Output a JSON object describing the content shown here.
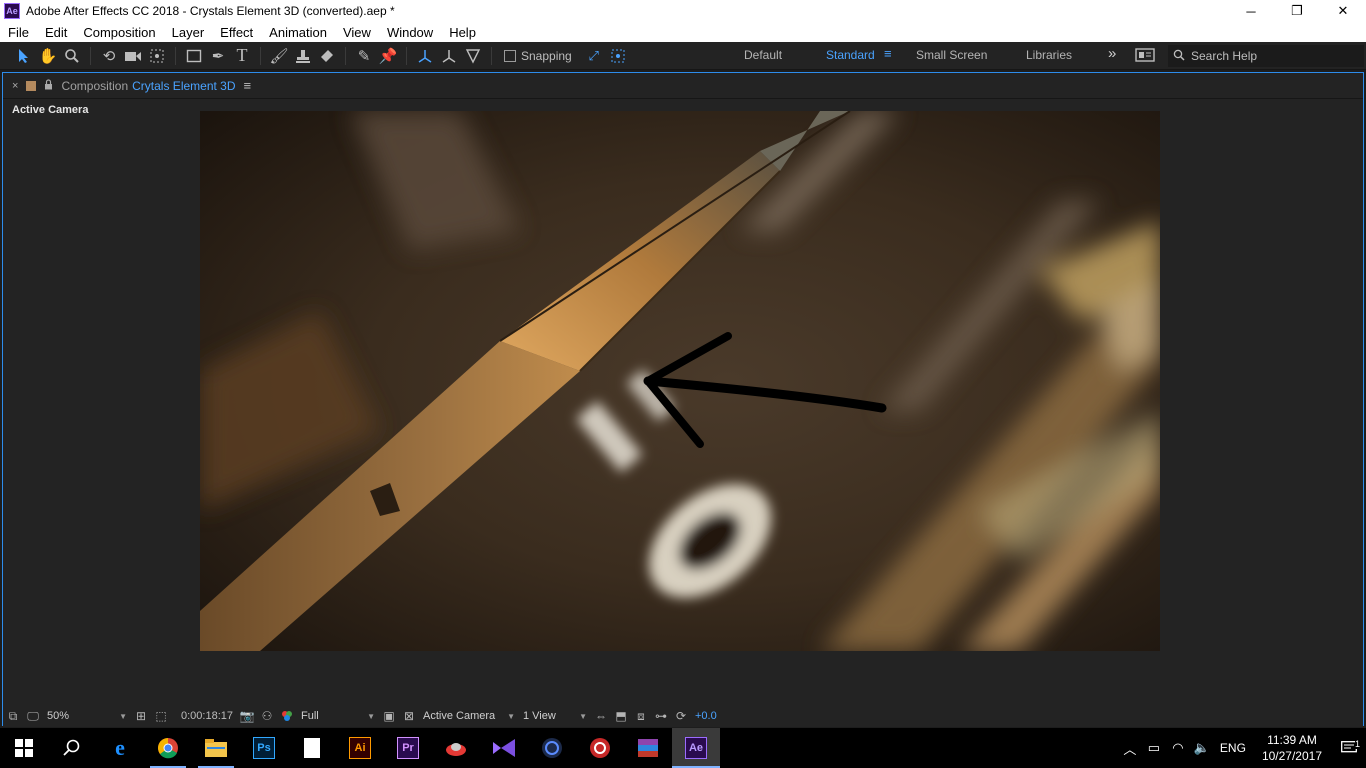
{
  "window": {
    "app_icon": "Ae",
    "title": "Adobe After Effects CC 2018 - Crystals Element 3D (converted).aep *",
    "minimize": "─",
    "maximize": "❐",
    "close": "✕"
  },
  "menu": {
    "items": [
      "File",
      "Edit",
      "Composition",
      "Layer",
      "Effect",
      "Animation",
      "View",
      "Window",
      "Help"
    ]
  },
  "toolbar": {
    "snapping_label": "Snapping",
    "workspaces": [
      "Default",
      "Standard",
      "Small Screen",
      "Libraries"
    ],
    "active_workspace": "Standard",
    "more": "»",
    "search_placeholder": "Search Help"
  },
  "panel": {
    "close": "×",
    "lock": "🔒",
    "prefix": "Composition",
    "comp_name": "Crytals Element 3D",
    "menu": "≡",
    "active_camera_label": "Active Camera"
  },
  "viewer_footer": {
    "zoom": "50%",
    "timecode": "0:00:18:17",
    "resolution": "Full",
    "camera": "Active Camera",
    "view_layout": "1 View",
    "exposure": "+0.0"
  },
  "taskbar": {
    "apps": [
      {
        "name": "edge",
        "label": "e",
        "color": "#1e90ff"
      },
      {
        "name": "chrome",
        "label": "",
        "color": "#f4b400"
      },
      {
        "name": "file-explorer",
        "label": "",
        "color": "#f3c54b"
      },
      {
        "name": "photoshop",
        "label": "Ps",
        "color": "#31a8ff"
      },
      {
        "name": "notepad",
        "label": "",
        "color": "#ffffff"
      },
      {
        "name": "illustrator",
        "label": "Ai",
        "color": "#ff9a00"
      },
      {
        "name": "premiere",
        "label": "Pr",
        "color": "#d291ff"
      },
      {
        "name": "app-red",
        "label": "",
        "color": "#e53935"
      },
      {
        "name": "visual-studio",
        "label": "",
        "color": "#9b6cff"
      },
      {
        "name": "cinema4d",
        "label": "",
        "color": "#5b8cff"
      },
      {
        "name": "app-target",
        "label": "",
        "color": "#e53935"
      },
      {
        "name": "winrar",
        "label": "",
        "color": "#8e44ad"
      },
      {
        "name": "after-effects",
        "label": "Ae",
        "color": "#9b6cff"
      }
    ],
    "language": "ENG",
    "time": "11:39 AM",
    "date": "10/27/2017",
    "notifications": "1"
  }
}
